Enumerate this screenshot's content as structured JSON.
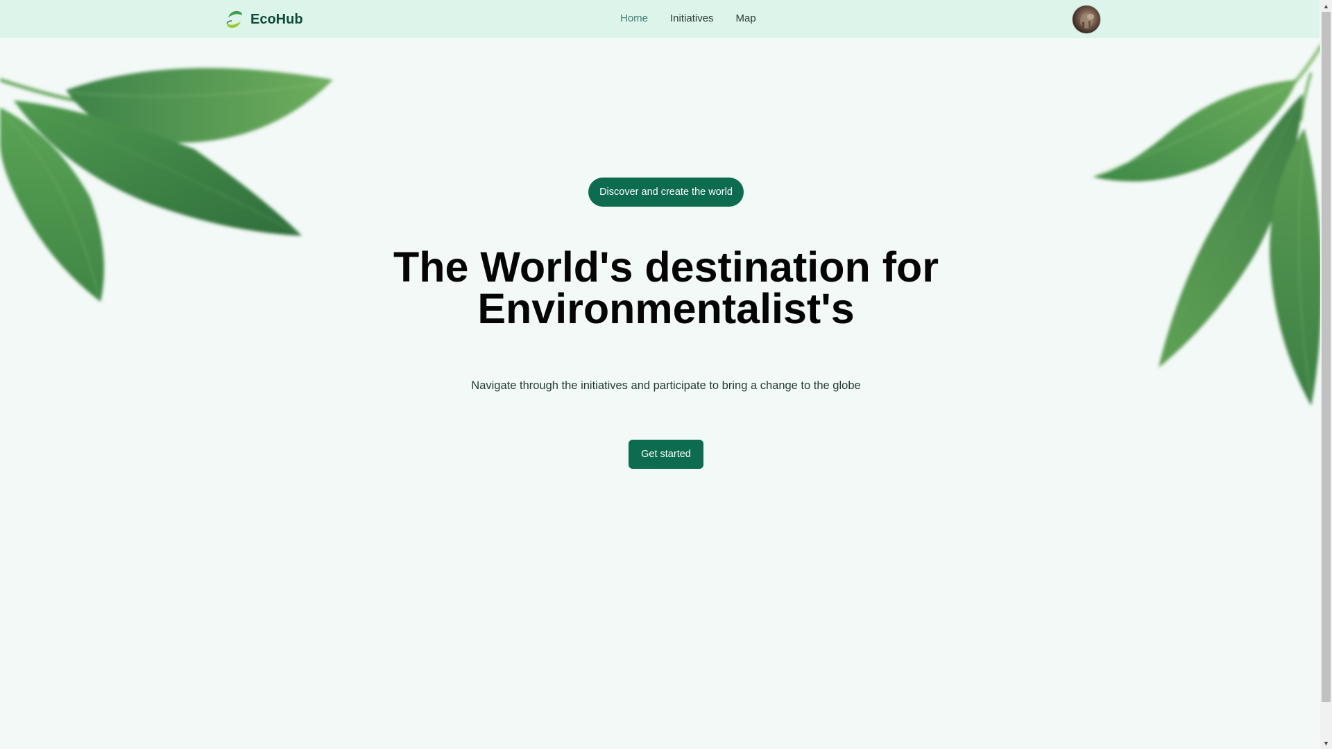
{
  "brand": {
    "name": "EcoHub",
    "logo_icon": "leaf-swirl-icon"
  },
  "nav": {
    "items": [
      {
        "label": "Home",
        "active": true
      },
      {
        "label": "Initiatives",
        "active": false
      },
      {
        "label": "Map",
        "active": false
      }
    ]
  },
  "avatar": {
    "icon": "user-avatar-icon"
  },
  "hero": {
    "tagline": "Discover and create the world",
    "headline_line1": "The World's destination for",
    "headline_line2": "Environmentalist's",
    "subtitle": "Navigate through the initiatives and participate to bring a change to the globe",
    "cta_label": "Get started"
  },
  "colors": {
    "primary": "#0d6b4f",
    "navbar_bg": "#dcf4ea",
    "page_bg": "#f2f9f6",
    "nav_active": "#3b7d75",
    "brand_text": "#0d4a3a"
  }
}
